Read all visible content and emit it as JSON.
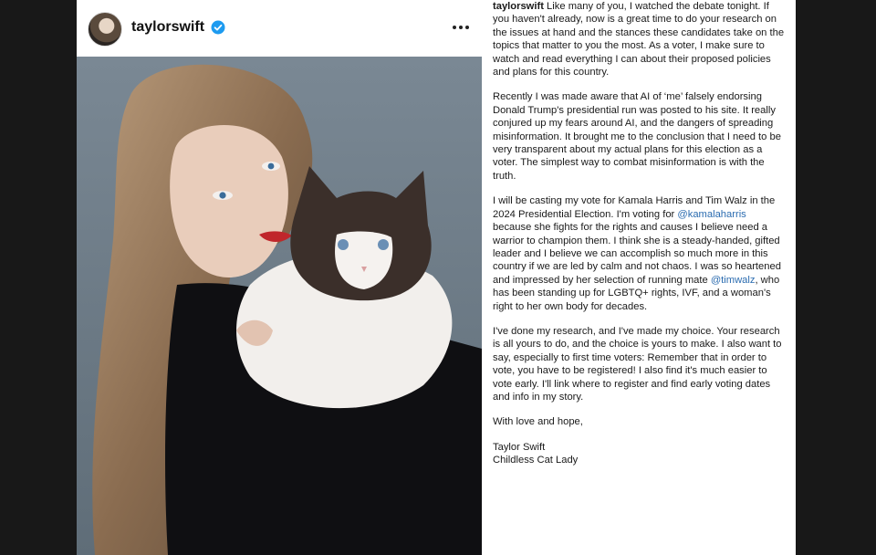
{
  "post": {
    "username": "taylorswift",
    "verified_icon": "verified-badge-icon",
    "more_icon": "more-options-icon",
    "colors": {
      "verified": "#1d9bf0",
      "mention": "#2b6cb0",
      "background": "#181818"
    }
  },
  "caption": {
    "p1_user": "taylorswift",
    "p1_text": " Like many of you, I watched the debate tonight. If you haven't already, now is a great time to do your research on the issues at hand and the stances these candidates take on the topics that matter to you the most. As a voter, I make sure to watch and read everything I can about their proposed policies and plans for this country.",
    "p2": "Recently I was made aware that AI of ‘me’ falsely endorsing Donald Trump's presidential run was posted to his site. It really conjured up my fears around AI, and the dangers of spreading misinformation. It brought me to the conclusion that I need to be very transparent about my actual plans for this election as a voter. The simplest way to combat misinformation is with the truth.",
    "p3_a": "I will be casting my vote for Kamala Harris and Tim Walz in the 2024 Presidential Election. I'm voting for ",
    "p3_mention1": "@kamalaharris",
    "p3_b": " because she fights for the rights and causes I believe need a warrior to champion them. I think she is a steady-handed, gifted leader and I believe we can accomplish so much more in this country if we are led by calm and not chaos. I was so heartened and impressed by her selection of running mate ",
    "p3_mention2": "@timwalz",
    "p3_c": ", who has been standing up for LGBTQ+ rights, IVF, and a woman's right to her own body for decades.",
    "p4": "I've done my research, and I've made my choice. Your research is all yours to do, and the choice is yours to make. I also want to say, especially to first time voters: Remember that in order to vote, you have to be registered! I also find it's much easier to vote early. I'll link where to register and find early voting dates and info in my story.",
    "p5": "With love and hope,",
    "sign1": "Taylor Swift",
    "sign2": "Childless Cat Lady"
  }
}
